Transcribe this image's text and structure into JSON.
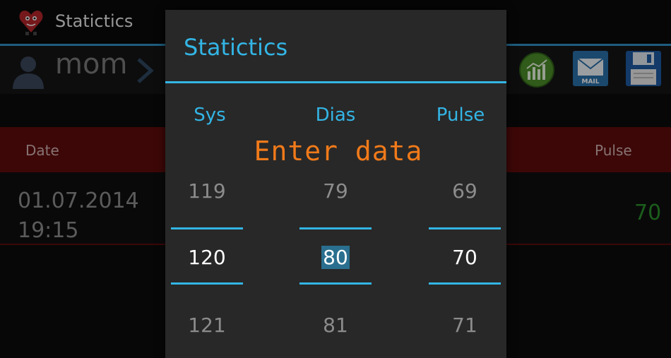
{
  "app": {
    "title": "Statictics"
  },
  "user": {
    "name": "mom"
  },
  "table": {
    "headers": {
      "date": "Date",
      "pulse": "Pulse"
    },
    "rows": [
      {
        "date": "01.07.2014",
        "time": "19:15",
        "pulse": "70"
      }
    ]
  },
  "dialog": {
    "title": "Statictics",
    "hint": "Enter data",
    "columns": [
      {
        "label": "Sys",
        "prev": "119",
        "current": "120",
        "next": "121"
      },
      {
        "label": "Dias",
        "prev": "79",
        "current": "80",
        "next": "81"
      },
      {
        "label": "Pulse",
        "prev": "69",
        "current": "70",
        "next": "71"
      }
    ]
  },
  "icons": {
    "app": "heart-app-icon",
    "user": "person-icon",
    "chevron": "chevron-right-icon",
    "chart": "chart-icon",
    "mail": "mail-icon",
    "save": "save-icon"
  },
  "colors": {
    "accent": "#33b5e5",
    "header_red": "#5e0b0b",
    "hint_orange": "#f07a1a",
    "pulse_green": "#2a8f2a"
  },
  "mail_label": "MAIL"
}
